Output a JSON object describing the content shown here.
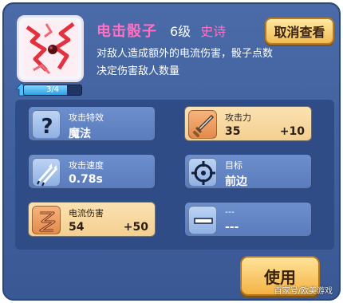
{
  "header": {
    "title": "电击骰子",
    "level": "6级",
    "rarity": "史诗",
    "description": "对敌人造成额外的电流伤害，骰子点数决定伤害敌人数量",
    "cancel_label": "取消查看"
  },
  "progress": {
    "text": "3/4",
    "fraction": 0.75
  },
  "stats": [
    {
      "label": "攻击特效",
      "value": "魔法",
      "bonus": "",
      "icon": "question-icon",
      "theme": "blue"
    },
    {
      "label": "攻击力",
      "value": "35",
      "bonus": "+10",
      "icon": "sword-icon",
      "theme": "orange"
    },
    {
      "label": "攻击速度",
      "value": "0.78s",
      "bonus": "",
      "icon": "arrows-icon",
      "theme": "blue"
    },
    {
      "label": "目标",
      "value": "前边",
      "bonus": "",
      "icon": "crosshair-icon",
      "theme": "blue"
    },
    {
      "label": "电流伤害",
      "value": "54",
      "bonus": "+50",
      "icon": "lightning-icon",
      "theme": "orange"
    },
    {
      "label": "---",
      "value": "---",
      "bonus": "",
      "icon": "dash-icon",
      "theme": "blue"
    }
  ],
  "footer": {
    "use_label": "使用"
  },
  "watermark": "百家号/欧美游戏",
  "colors": {
    "panel": "#4a6ba8",
    "title_pink": "#ff6fc3",
    "button_gold": "#f4b344",
    "stat_orange": "#f4cf90"
  }
}
